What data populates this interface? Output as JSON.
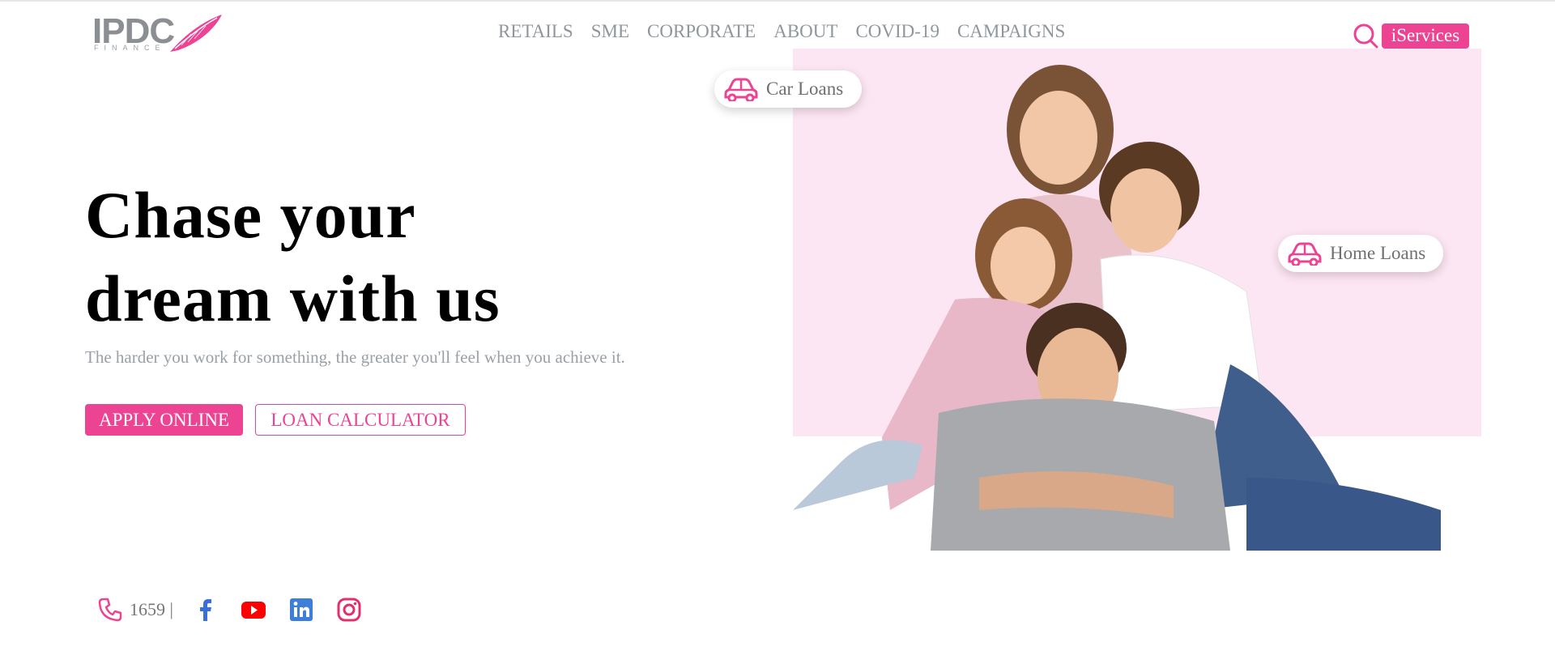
{
  "brand": {
    "logo_text": "IPDC",
    "logo_sub": "FINANCE",
    "accent": "#ec4393",
    "panel_color": "#fde6f3"
  },
  "nav": {
    "items": [
      "RETAILS",
      "SME",
      "CORPORATE",
      "ABOUT",
      "COVID-19",
      "CAMPAIGNS"
    ]
  },
  "header": {
    "search_icon": "search-icon",
    "iservices_label": "iServices"
  },
  "hero": {
    "title_line1": "Chase your",
    "title_line2": "dream with us",
    "subtitle": "The harder you work for something, the greater you'll feel when you achieve it.",
    "apply_label": "APPLY ONLINE",
    "calculator_label": "LOAN CALCULATOR"
  },
  "tags": {
    "car_loans": "Car Loans",
    "home_loans": "Home Loans"
  },
  "footer": {
    "phone": "1659 |",
    "socials": [
      "facebook-icon",
      "youtube-icon",
      "linkedin-icon",
      "instagram-icon"
    ]
  }
}
